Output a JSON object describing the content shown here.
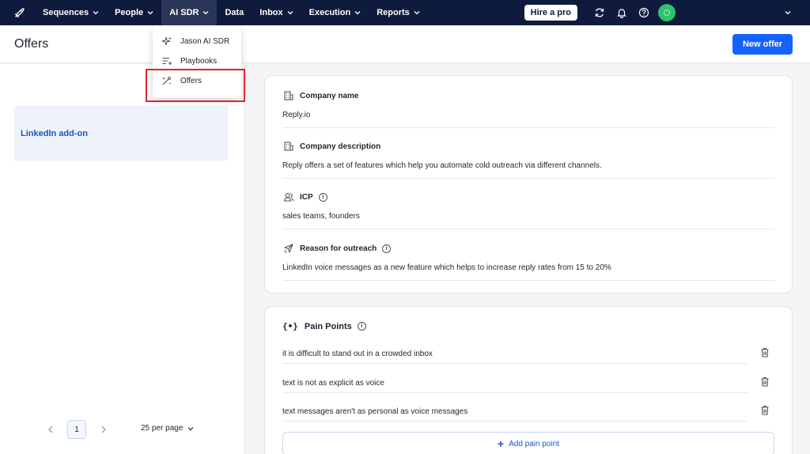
{
  "nav": {
    "items": [
      {
        "label": "Sequences",
        "has_chevron": true
      },
      {
        "label": "People",
        "has_chevron": true
      },
      {
        "label": "AI SDR",
        "has_chevron": true,
        "active": true
      },
      {
        "label": "Data",
        "has_chevron": false
      },
      {
        "label": "Inbox",
        "has_chevron": true
      },
      {
        "label": "Execution",
        "has_chevron": true
      },
      {
        "label": "Reports",
        "has_chevron": true
      }
    ],
    "hire_label": "Hire a pro",
    "icons": [
      "rocket-icon",
      "refresh-icon",
      "bell-icon",
      "help-icon"
    ],
    "avatar_color": "#2ec36b"
  },
  "dropdown": {
    "items": [
      {
        "label": "Jason AI SDR",
        "icon": "sparkle-icon"
      },
      {
        "label": "Playbooks",
        "icon": "playbook-list-icon"
      },
      {
        "label": "Offers",
        "icon": "magic-wand-icon"
      }
    ]
  },
  "header": {
    "title": "Offers",
    "new_offer_label": "New offer"
  },
  "offers": {
    "items": [
      {
        "label": "LinkedIn add-on"
      }
    ],
    "pager": {
      "page": "1",
      "per_page": "25 per page"
    }
  },
  "details": {
    "company_name": {
      "label": "Company name",
      "value": "Reply.io"
    },
    "company_description": {
      "label": "Company description",
      "value": "Reply offers a set of features which help you automate cold outreach via different channels."
    },
    "icp": {
      "label": "ICP",
      "value": "sales teams, founders"
    },
    "reason": {
      "label": "Reason for outreach",
      "value": "LinkedIn voice messages as a new feature which helps to increase reply rates from 15 to 20%"
    }
  },
  "pain_points": {
    "title": "Pain Points",
    "items": [
      "it is difficult to stand out in a crowded inbox",
      "text is not as explicit as voice",
      "text messages aren't as personal as voice messages"
    ],
    "add_label": "Add pain point"
  },
  "colors": {
    "nav_bg": "#0f1b3d",
    "accent": "#1463ff",
    "highlight": "#e0232b"
  }
}
